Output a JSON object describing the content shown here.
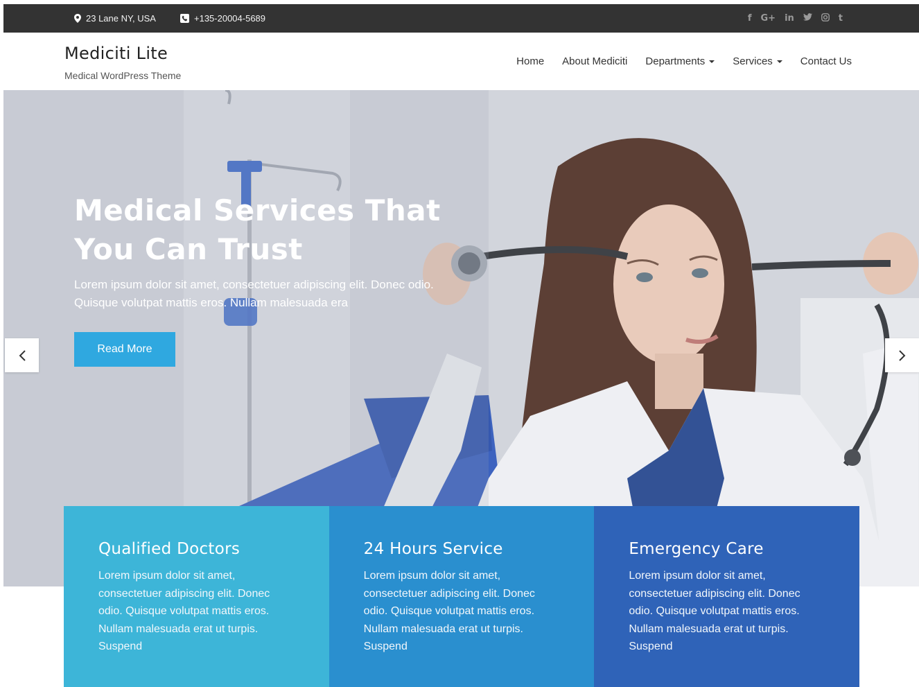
{
  "colors": {
    "topbar_bg": "#333333",
    "accent": "#2fa8e0",
    "feature_1": "#3db5d8",
    "feature_2": "#2a8fcf",
    "feature_3": "#2f63b8"
  },
  "topbar": {
    "address": "23 Lane NY, USA",
    "phone": "+135-20004-5689",
    "social": [
      {
        "icon": "facebook-icon",
        "glyph": "f"
      },
      {
        "icon": "google-plus-icon",
        "glyph": "G+"
      },
      {
        "icon": "linkedin-icon",
        "glyph": "in"
      },
      {
        "icon": "twitter-icon",
        "glyph": "🐦"
      },
      {
        "icon": "instagram-icon",
        "glyph": "◎"
      },
      {
        "icon": "tumblr-icon",
        "glyph": "t"
      }
    ]
  },
  "header": {
    "site_title": "Mediciti Lite",
    "tagline": "Medical WordPress Theme",
    "nav": [
      {
        "label": "Home",
        "dropdown": false
      },
      {
        "label": "About Mediciti",
        "dropdown": false
      },
      {
        "label": "Departments",
        "dropdown": true
      },
      {
        "label": "Services",
        "dropdown": true
      },
      {
        "label": "Contact Us",
        "dropdown": false
      }
    ]
  },
  "hero": {
    "title": "Medical Services That You Can Trust",
    "text": "Lorem ipsum dolor sit amet, consectetuer adipiscing elit. Donec odio. Quisque volutpat mattis eros. Nullam malesuada era",
    "button": "Read More",
    "prev_icon": "chevron-left-icon",
    "next_icon": "chevron-right-icon"
  },
  "features": [
    {
      "title": "Qualified Doctors",
      "text": "Lorem ipsum dolor sit amet, consectetuer adipiscing elit. Donec odio. Quisque volutpat mattis eros. Nullam malesuada erat ut turpis. Suspend"
    },
    {
      "title": "24 Hours Service",
      "text": "Lorem ipsum dolor sit amet, consectetuer adipiscing elit. Donec odio. Quisque volutpat mattis eros. Nullam malesuada erat ut turpis. Suspend"
    },
    {
      "title": "Emergency Care",
      "text": "Lorem ipsum dolor sit amet, consectetuer adipiscing elit. Donec odio. Quisque volutpat mattis eros. Nullam malesuada erat ut turpis. Suspend"
    }
  ]
}
